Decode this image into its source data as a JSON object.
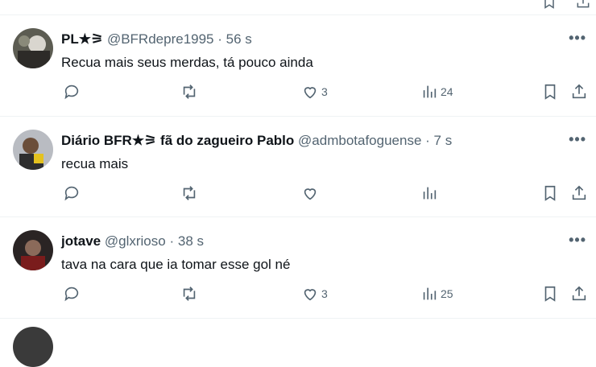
{
  "tweets": [
    {
      "name": "PL★⚞",
      "handle": "@BFRdepre1995",
      "separator": "·",
      "time": "56 s",
      "text": "Recua mais seus merdas, tá pouco ainda",
      "likes": "3",
      "views": "24"
    },
    {
      "name": "Diário BFR★⚞ fã do zagueiro Pablo",
      "handle": "@admbotafoguense",
      "separator": "·",
      "time": "7 s",
      "text": "recua mais",
      "likes": "",
      "views": ""
    },
    {
      "name": "jotave",
      "handle": "@glxrioso",
      "separator": "·",
      "time": "38 s",
      "text": "tava na cara que ia tomar esse gol né",
      "likes": "3",
      "views": "25"
    }
  ],
  "more_label": "•••",
  "icons": [
    "reply-icon",
    "retweet-icon",
    "heart-icon",
    "views-icon",
    "bookmark-icon",
    "share-icon",
    "more-icon"
  ]
}
